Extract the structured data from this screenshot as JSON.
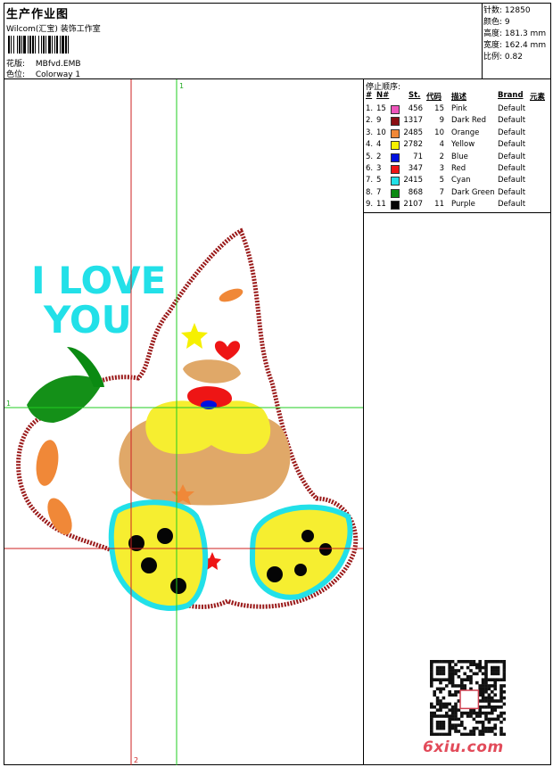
{
  "header": {
    "title": "生产作业图",
    "company": "Wilcom(汇宝) 装饰工作室",
    "design_label": "花版:",
    "design_value": "MBfvd.EMB",
    "colorway_label": "色位:",
    "colorway_value": "Colorway 1"
  },
  "stats": [
    {
      "label": "针数:",
      "value": "12850"
    },
    {
      "label": "颜色:",
      "value": "9"
    },
    {
      "label": "高度:",
      "value": "181.3 mm"
    },
    {
      "label": "宽度:",
      "value": "162.4 mm"
    },
    {
      "label": "比例:",
      "value": "0.82"
    }
  ],
  "stop_sequence": {
    "title": "停止顺序:",
    "columns": {
      "index": "#",
      "needle": "N#",
      "stitches": "St.",
      "code": "代码",
      "description": "描述",
      "brand": "Brand",
      "element": "元素"
    },
    "rows": [
      {
        "index": "1.",
        "needle": "15",
        "color": "#ee55bb",
        "stitches": "456",
        "code": "15",
        "description": "Pink",
        "brand": "Default"
      },
      {
        "index": "2.",
        "needle": "9",
        "color": "#8b0e12",
        "stitches": "1317",
        "code": "9",
        "description": "Dark Red",
        "brand": "Default"
      },
      {
        "index": "3.",
        "needle": "10",
        "color": "#f08838",
        "stitches": "2485",
        "code": "10",
        "description": "Orange",
        "brand": "Default"
      },
      {
        "index": "4.",
        "needle": "4",
        "color": "#f6f000",
        "stitches": "2782",
        "code": "4",
        "description": "Yellow",
        "brand": "Default"
      },
      {
        "index": "5.",
        "needle": "2",
        "color": "#0010e0",
        "stitches": "71",
        "code": "2",
        "description": "Blue",
        "brand": "Default"
      },
      {
        "index": "6.",
        "needle": "3",
        "color": "#ee1515",
        "stitches": "347",
        "code": "3",
        "description": "Red",
        "brand": "Default"
      },
      {
        "index": "7.",
        "needle": "5",
        "color": "#22e0e8",
        "stitches": "2415",
        "code": "5",
        "description": "Cyan",
        "brand": "Default"
      },
      {
        "index": "8.",
        "needle": "7",
        "color": "#0b8a12",
        "stitches": "868",
        "code": "7",
        "description": "Dark Green",
        "brand": "Default"
      },
      {
        "index": "9.",
        "needle": "11",
        "color": "#050505",
        "stitches": "2107",
        "code": "11",
        "description": "Purple",
        "brand": "Default"
      }
    ]
  },
  "design": {
    "text_line1": "I LOVE",
    "text_line2": "YOU",
    "text_color": "#22e0e8",
    "guide_label_1": "1",
    "guide_label_2": "2",
    "guide_color_green": "#22cc22",
    "guide_color_red": "#cc2222"
  },
  "watermark": "6xiu.com"
}
